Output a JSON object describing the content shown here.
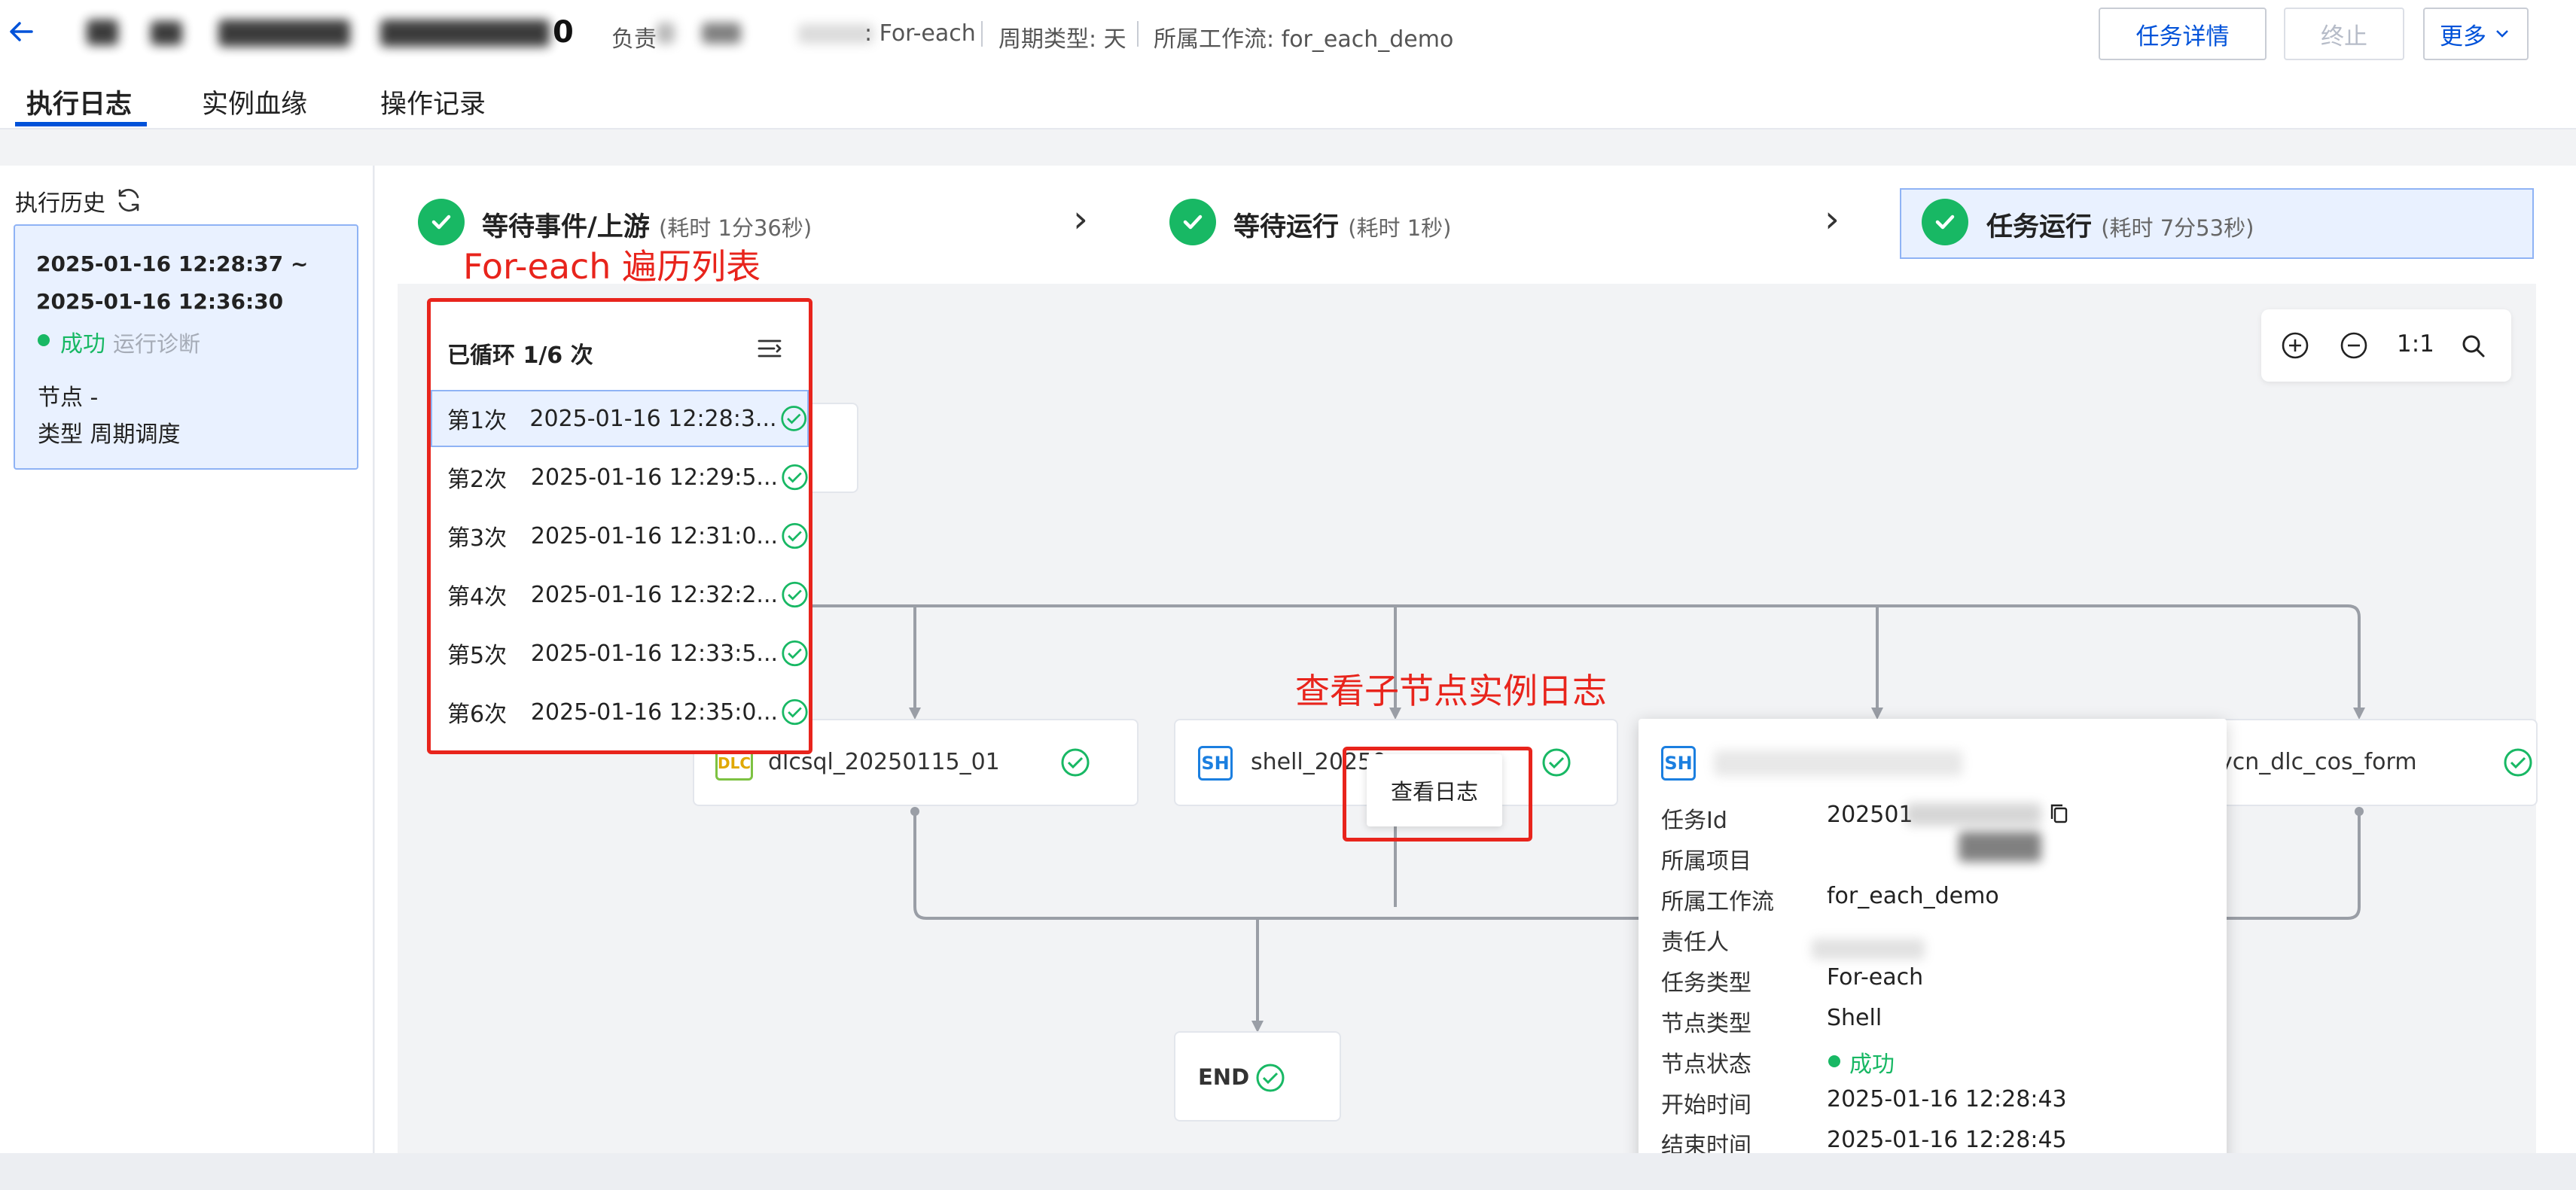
{
  "header": {
    "title_suffix": "0",
    "meta": {
      "owner_prefix": "负责",
      "task_type": ": For-each",
      "cycle_type": "周期类型: 天",
      "workflow": "所属工作流: for_each_demo"
    },
    "buttons": {
      "details": "任务详情",
      "stop": "终止",
      "more": "更多"
    },
    "tabs": [
      "执行日志",
      "实例血缘",
      "操作记录"
    ]
  },
  "history": {
    "title": "执行历史",
    "start": "2025-01-16 12:28:37 ~",
    "end": "2025-01-16 12:36:30",
    "status": "成功",
    "diagnose": "运行诊断",
    "node": "节点 -",
    "type": "类型 周期调度"
  },
  "steps": [
    {
      "title": "等待事件/上游",
      "sub": "(耗时 1分36秒)"
    },
    {
      "title": "等待运行",
      "sub": "(耗时 1秒)"
    },
    {
      "title": "任务运行",
      "sub": "(耗时 7分53秒)"
    }
  ],
  "annotations": {
    "loop_list": "For-each 遍历列表",
    "child_log": "查看子节点实例日志"
  },
  "loop": {
    "title": "已循环 1/6 次",
    "rows": [
      {
        "n": "第1次",
        "t": "2025-01-16 12:28:3..."
      },
      {
        "n": "第2次",
        "t": "2025-01-16 12:29:5..."
      },
      {
        "n": "第3次",
        "t": "2025-01-16 12:31:0..."
      },
      {
        "n": "第4次",
        "t": "2025-01-16 12:32:2..."
      },
      {
        "n": "第5次",
        "t": "2025-01-16 12:33:5..."
      },
      {
        "n": "第6次",
        "t": "2025-01-16 12:35:0..."
      }
    ]
  },
  "zoom": {
    "ratio": "1:1"
  },
  "nodes": {
    "dlc": {
      "icon": "DLC",
      "label": "dlcsql_20250115_01"
    },
    "shell": {
      "icon": "SH",
      "label": "shell_20250"
    },
    "right": {
      "label": "ycn_dlc_cos_form"
    },
    "end": {
      "label": "END"
    },
    "view_log": "查看日志"
  },
  "tooltip": {
    "icon": "SH",
    "rows": [
      {
        "k": "任务Id",
        "v": "202501"
      },
      {
        "k": "所属项目",
        "v": ""
      },
      {
        "k": "所属工作流",
        "v": "for_each_demo"
      },
      {
        "k": "责任人",
        "v": ""
      },
      {
        "k": "任务类型",
        "v": "For-each"
      },
      {
        "k": "节点类型",
        "v": "Shell"
      },
      {
        "k": "节点状态",
        "v": "成功"
      },
      {
        "k": "开始时间",
        "v": "2025-01-16 12:28:43"
      },
      {
        "k": "结束时间",
        "v": "2025-01-16 12:28:45"
      }
    ]
  },
  "colors": {
    "accent": "#0052d9",
    "success": "#18b864",
    "annotation": "#e8241c",
    "selected_bg": "#e9f1ff"
  }
}
